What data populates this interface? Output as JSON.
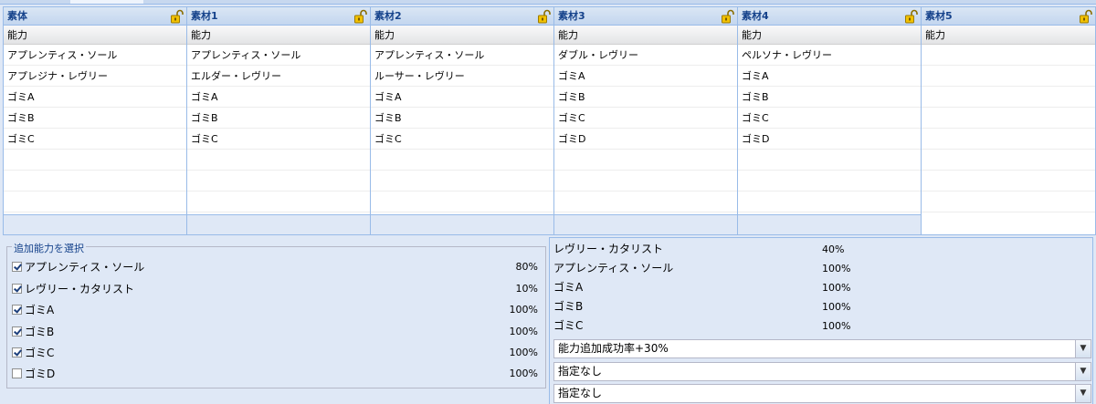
{
  "panels": [
    {
      "title": "素体",
      "column": "能力",
      "rows": [
        "アプレンティス・ソール",
        "アプレジナ・レヴリー",
        "ゴミA",
        "ゴミB",
        "ゴミC"
      ],
      "locked": true
    },
    {
      "title": "素材1",
      "column": "能力",
      "rows": [
        "アプレンティス・ソール",
        "エルダー・レヴリー",
        "ゴミA",
        "ゴミB",
        "ゴミC"
      ],
      "locked": true
    },
    {
      "title": "素材2",
      "column": "能力",
      "rows": [
        "アプレンティス・ソール",
        "ルーサー・レヴリー",
        "ゴミA",
        "ゴミB",
        "ゴミC"
      ],
      "locked": true
    },
    {
      "title": "素材3",
      "column": "能力",
      "rows": [
        "ダブル・レヴリー",
        "ゴミA",
        "ゴミB",
        "ゴミC",
        "ゴミD"
      ],
      "locked": true
    },
    {
      "title": "素材4",
      "column": "能力",
      "rows": [
        "ペルソナ・レヴリー",
        "ゴミA",
        "ゴミB",
        "ゴミC",
        "ゴミD"
      ],
      "locked": true
    },
    {
      "title": "素材5",
      "column": "能力",
      "rows": [],
      "locked": false
    }
  ],
  "select": {
    "legend": "追加能力を選択",
    "items": [
      {
        "label": "アプレンティス・ソール",
        "pct": "80%",
        "checked": true
      },
      {
        "label": "レヴリー・カタリスト",
        "pct": "10%",
        "checked": true
      },
      {
        "label": "ゴミA",
        "pct": "100%",
        "checked": true
      },
      {
        "label": "ゴミB",
        "pct": "100%",
        "checked": true
      },
      {
        "label": "ゴミC",
        "pct": "100%",
        "checked": true
      },
      {
        "label": "ゴミD",
        "pct": "100%",
        "checked": false
      }
    ]
  },
  "result": {
    "items": [
      {
        "label": "レヴリー・カタリスト",
        "pct": "40%"
      },
      {
        "label": "アプレンティス・ソール",
        "pct": "100%"
      },
      {
        "label": "ゴミA",
        "pct": "100%"
      },
      {
        "label": "ゴミB",
        "pct": "100%"
      },
      {
        "label": "ゴミC",
        "pct": "100%"
      }
    ],
    "combos": [
      "能力追加成功率+30%",
      "指定なし",
      "指定なし"
    ]
  },
  "icons": {
    "lock": "lock-icon",
    "dropdown": "chevron-down-icon"
  },
  "colors": {
    "header_text": "#15428b",
    "border": "#99bbe8",
    "bg": "#dfe8f6",
    "lock": "#e8b800"
  }
}
